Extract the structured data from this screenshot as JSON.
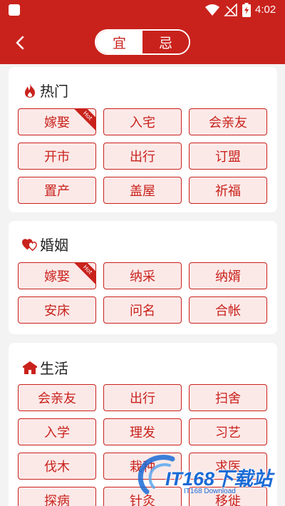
{
  "status_bar": {
    "time": "4:02"
  },
  "header": {
    "tabs": [
      {
        "label": "宜",
        "active": true
      },
      {
        "label": "忌",
        "active": false
      }
    ]
  },
  "sections": {
    "hot": {
      "title": "热门",
      "items": [
        {
          "label": "嫁娶",
          "badge": "Hot"
        },
        {
          "label": "入宅"
        },
        {
          "label": "会亲友"
        },
        {
          "label": "开市"
        },
        {
          "label": "出行"
        },
        {
          "label": "订盟"
        },
        {
          "label": "置产"
        },
        {
          "label": "盖屋"
        },
        {
          "label": "祈福"
        }
      ]
    },
    "marriage": {
      "title": "婚姻",
      "items": [
        {
          "label": "嫁娶",
          "badge": "Hot"
        },
        {
          "label": "纳采"
        },
        {
          "label": "纳婿"
        },
        {
          "label": "安床"
        },
        {
          "label": "问名"
        },
        {
          "label": "合帐"
        }
      ]
    },
    "life": {
      "title": "生活",
      "items": [
        {
          "label": "会亲友"
        },
        {
          "label": "出行"
        },
        {
          "label": "扫舍"
        },
        {
          "label": "入学"
        },
        {
          "label": "理发"
        },
        {
          "label": "习艺"
        },
        {
          "label": "伐木"
        },
        {
          "label": "栽种"
        },
        {
          "label": "求医"
        },
        {
          "label": "探病"
        },
        {
          "label": "针灸"
        },
        {
          "label": "移徙"
        }
      ]
    }
  },
  "watermark": {
    "main": "IT168下载站",
    "sub": "IT168 Download"
  },
  "colors": {
    "primary": "#c9221c",
    "tag_bg": "#fbe9e8",
    "page_bg": "#f3f3f3"
  }
}
